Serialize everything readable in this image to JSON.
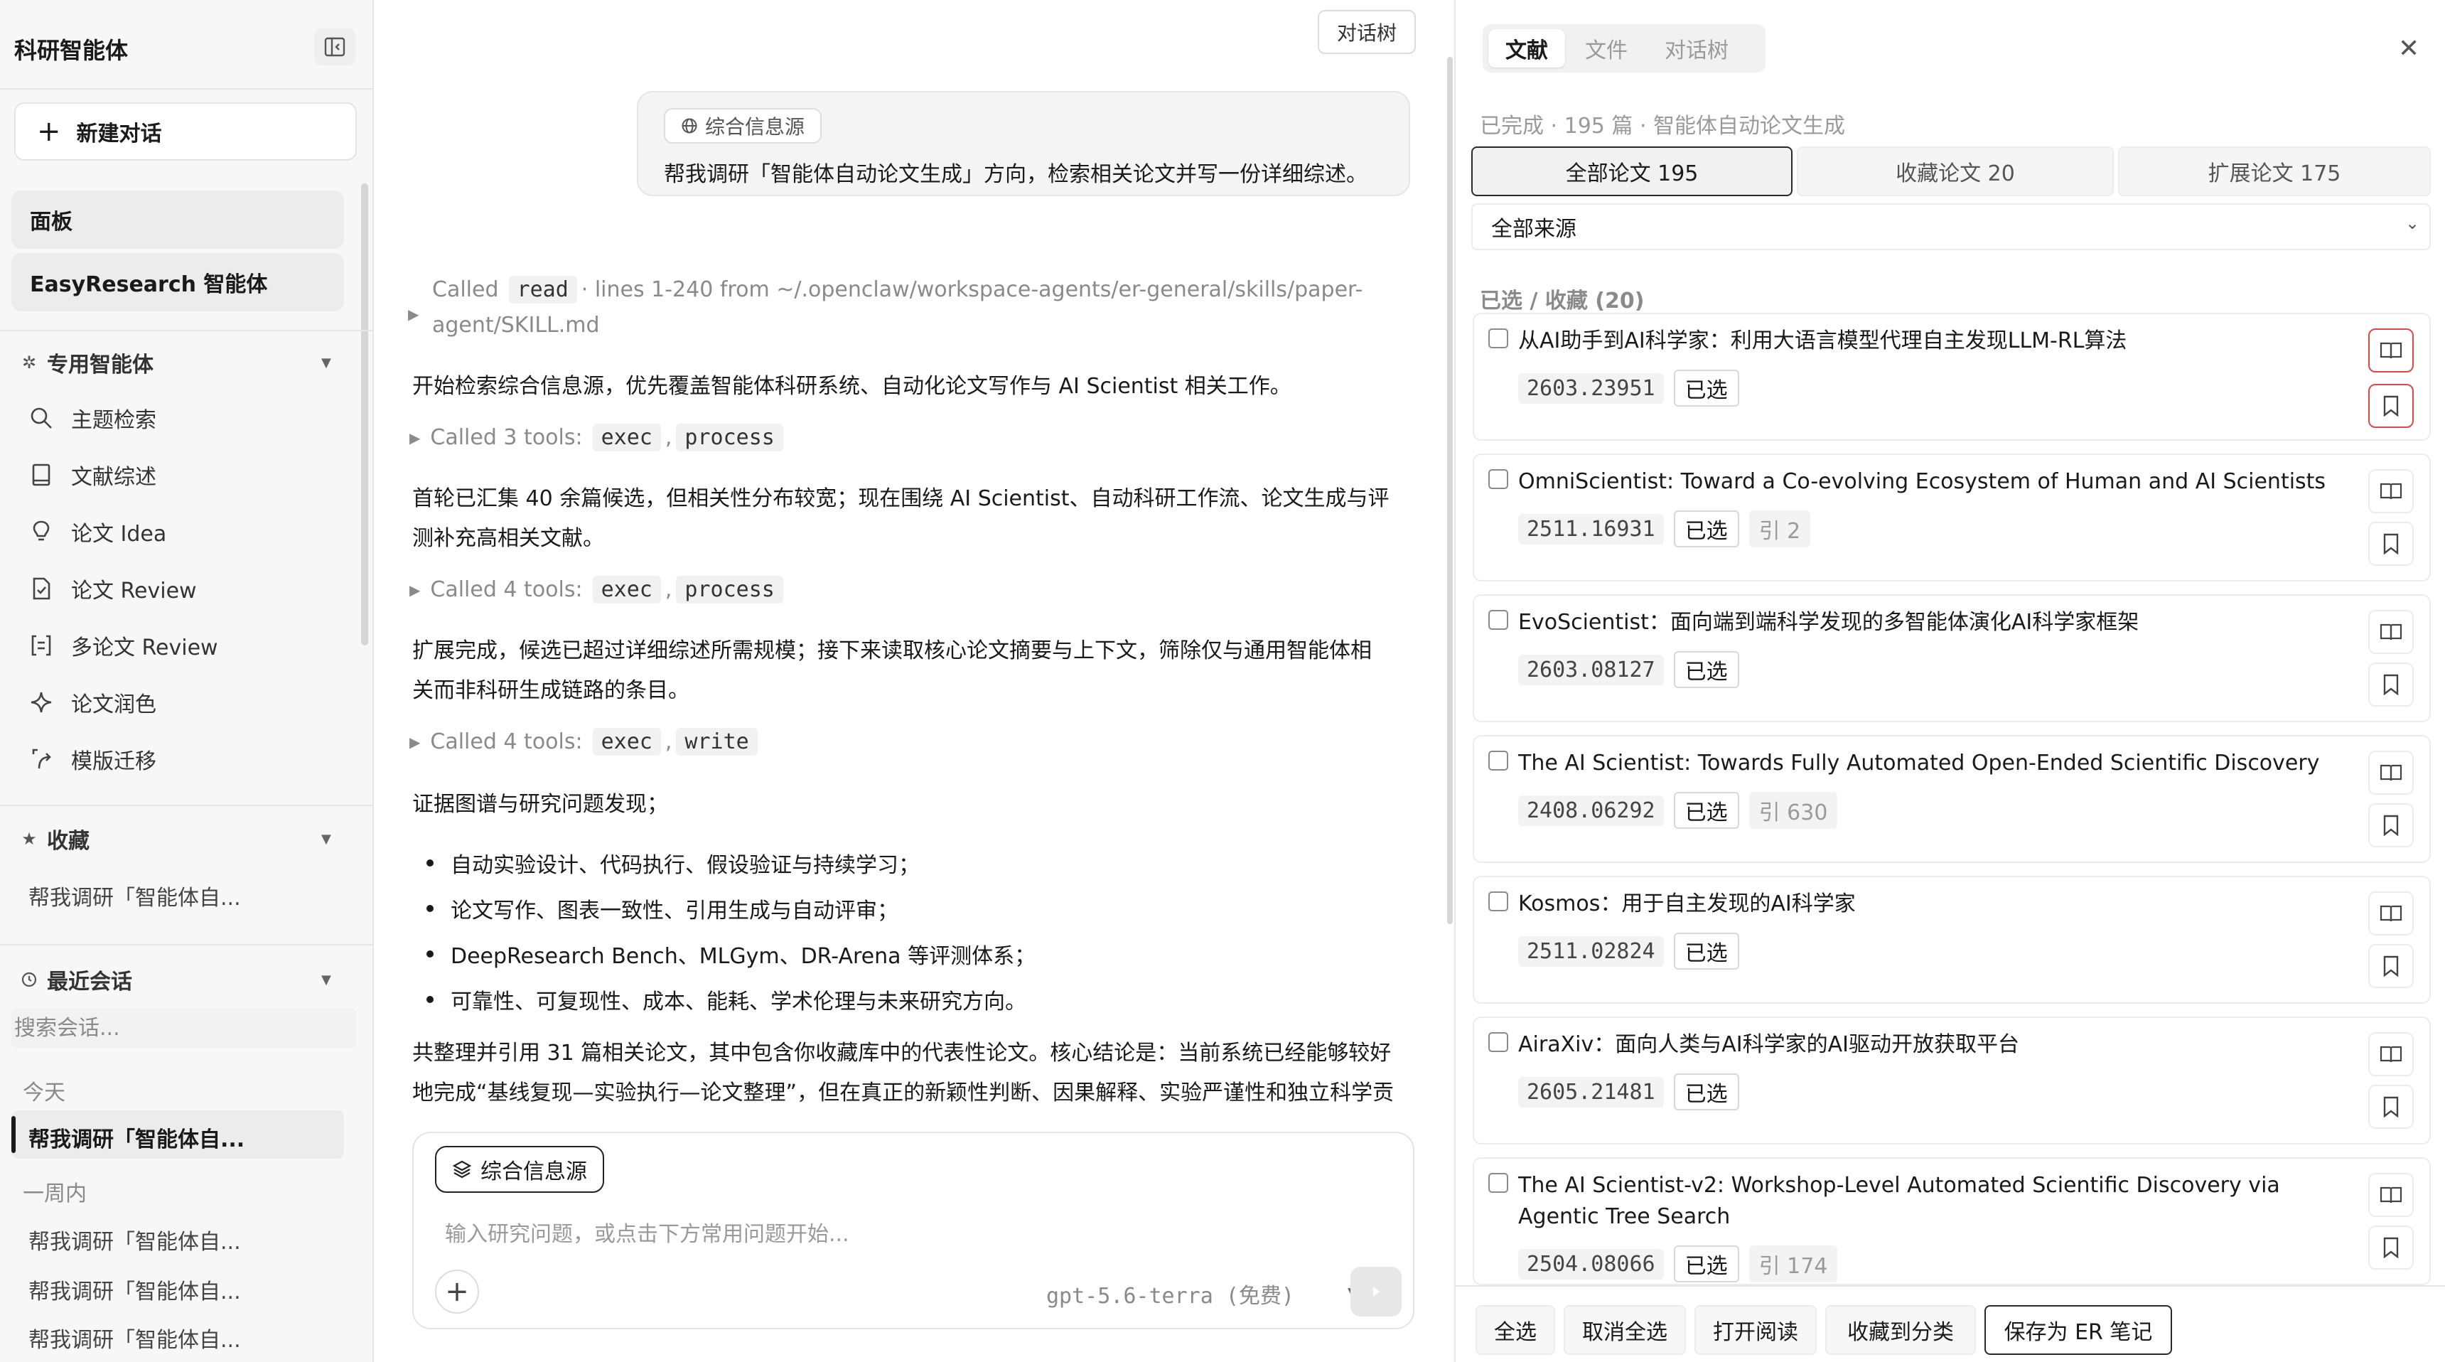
{
  "sidebar": {
    "app_title": "科研智能体",
    "new_chat": "新建对话",
    "panel_label": "面板",
    "easy_research": "EasyResearch 智能体",
    "section_agents": "专用智能体",
    "agents": [
      {
        "label": "主题检索",
        "icon": "search-icon"
      },
      {
        "label": "文献综述",
        "icon": "book-icon"
      },
      {
        "label": "论文 Idea",
        "icon": "lightbulb-icon"
      },
      {
        "label": "论文 Review",
        "icon": "doc-check-icon"
      },
      {
        "label": "多论文 Review",
        "icon": "bracket-doc-icon"
      },
      {
        "label": "论文润色",
        "icon": "sparkle-icon"
      },
      {
        "label": "模版迁移",
        "icon": "transfer-icon"
      }
    ],
    "section_favorites": "收藏",
    "favorites": [
      "帮我调研「智能体自..."
    ],
    "section_recent": "最近会话",
    "search_placeholder": "搜索会话...",
    "group_today": "今天",
    "today_items": [
      "帮我调研「智能体自..."
    ],
    "group_week": "一周内",
    "week_items": [
      "帮我调研「智能体自...",
      "帮我调研「智能体自...",
      "帮我调研「智能体自..."
    ]
  },
  "chat": {
    "tree_button": "对话树",
    "user_chip": "综合信息源",
    "user_message": "帮我调研「智能体自动论文生成」方向，检索相关论文并写一份详细综述。",
    "tool1_prefix": "Called",
    "tool1_code": "read",
    "tool1_rest": "· lines 1-240 from ~/.openclaw/workspace-agents/er-general/skills/paper-",
    "tool1_rest2": "agent/SKILL.md",
    "p1": "开始检索综合信息源，优先覆盖智能体科研系统、自动化论文写作与 AI Scientist 相关工作。",
    "tool2_prefix": "Called 3 tools:",
    "tool2_codes": [
      "exec",
      "process"
    ],
    "p2a": "首轮已汇集 40 余篇候选，但相关性分布较宽；现在围绕 AI Scientist、自动科研工作流、论文生成与评",
    "p2b": "测补充高相关文献。",
    "tool3_prefix": "Called 4 tools:",
    "tool3_codes": [
      "exec",
      "process"
    ],
    "p3a": "扩展完成，候选已超过详细综述所需规模；接下来读取核心论文摘要与上下文，筛除仅与通用智能体相",
    "p3b": "关而非科研生成链路的条目。",
    "tool4_prefix": "Called 4 tools:",
    "tool4_codes": [
      "exec",
      "write"
    ],
    "p4": "证据图谱与研究问题发现；",
    "bullets": [
      "自动实验设计、代码执行、假设验证与持续学习；",
      "论文写作、图表一致性、引用生成与自动评审；",
      "DeepResearch Bench、MLGym、DR-Arena 等评测体系；",
      "可靠性、可复现性、成本、能耗、学术伦理与未来研究方向。"
    ],
    "p5a": "共整理并引用 31 篇相关论文，其中包含你收藏库中的代表性论文。核心结论是：当前系统已经能够较好",
    "p5b": "地完成“基线复现—实验执行—论文整理”，但在真正的新颖性判断、因果解释、实验严谨性和独立科学贡",
    "composer_chip": "综合信息源",
    "composer_placeholder": "输入研究问题，或点击下方常用问题开始...",
    "model": "gpt-5.6-terra (免费)"
  },
  "panel": {
    "tabs": [
      "文献",
      "文件",
      "对话树"
    ],
    "status": "已完成 · 195 篇 · 智能体自动论文生成",
    "filters": [
      "全部论文 195",
      "收藏论文 20",
      "扩展论文 175"
    ],
    "source": "全部来源",
    "selected_heading": "已选 / 收藏 (20)",
    "papers": [
      {
        "title": "从AI助手到AI科学家：利用大语言模型代理自主发现LLM-RL算法",
        "id": "2603.23951",
        "badge": "已选",
        "cite": ""
      },
      {
        "title": "OmniScientist: Toward a Co-evolving Ecosystem of Human and AI Scientists",
        "id": "2511.16931",
        "badge": "已选",
        "cite": "引 2"
      },
      {
        "title": "EvoScientist：面向端到端科学发现的多智能体演化AI科学家框架",
        "id": "2603.08127",
        "badge": "已选",
        "cite": ""
      },
      {
        "title": "The AI Scientist: Towards Fully Automated Open-Ended Scientific Discovery",
        "id": "2408.06292",
        "badge": "已选",
        "cite": "引 630"
      },
      {
        "title": "Kosmos：用于自主发现的AI科学家",
        "id": "2511.02824",
        "badge": "已选",
        "cite": ""
      },
      {
        "title": "AiraXiv：面向人类与AI科学家的AI驱动开放获取平台",
        "id": "2605.21481",
        "badge": "已选",
        "cite": ""
      },
      {
        "title": "The AI Scientist-v2: Workshop-Level Automated Scientific Discovery via Agentic Tree Search",
        "id": "2504.08066",
        "badge": "已选",
        "cite": "引 174"
      }
    ],
    "actions": [
      "全选",
      "取消全选",
      "打开阅读",
      "收藏到分类",
      "保存为 ER 笔记"
    ]
  }
}
